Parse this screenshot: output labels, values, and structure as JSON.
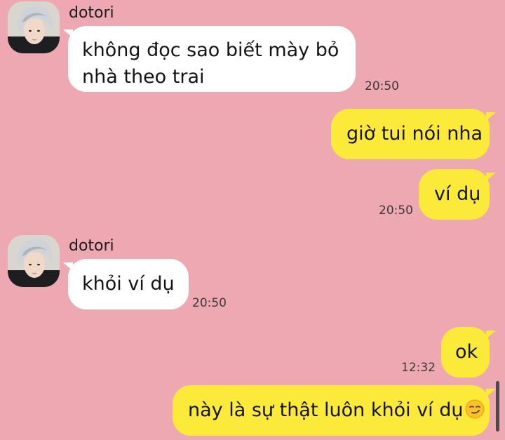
{
  "colors": {
    "background": "#eda8b1",
    "incoming_bubble": "#ffffff",
    "outgoing_bubble": "#fcea3a"
  },
  "messages": [
    {
      "direction": "in",
      "sender": "dotori",
      "lines": [
        "không đọc sao biết mày bỏ",
        "nhà theo trai"
      ],
      "time": "20:50",
      "avatar_icon": "user-avatar"
    },
    {
      "direction": "out",
      "text": "giờ tui nói nha"
    },
    {
      "direction": "out",
      "text": "ví dụ",
      "time": "20:50"
    },
    {
      "direction": "in",
      "sender": "dotori",
      "text": "khỏi ví dụ",
      "time": "20:50",
      "avatar_icon": "user-avatar"
    },
    {
      "direction": "out",
      "text": "ok",
      "time": "12:32"
    },
    {
      "direction": "out",
      "text": "này là sự thật luôn khỏi ví dụ",
      "emoji": "smirking-face-icon"
    }
  ]
}
